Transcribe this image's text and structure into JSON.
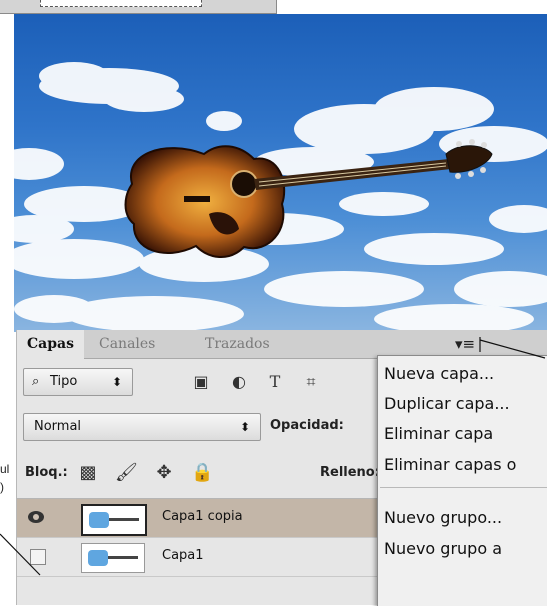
{
  "panel": {
    "tabs": [
      "Capas",
      "Canales",
      "Trazados"
    ],
    "menu_button_icon": "panel-menu-icon",
    "filter": {
      "kind_label": "Tipo"
    },
    "blend_mode": "Normal",
    "opacity_label": "Opacidad:",
    "lock_label": "Bloq.:",
    "fill_label": "Relleno:",
    "layers": [
      {
        "name": "Capa1 copia",
        "visible": true,
        "selected": true
      },
      {
        "name": "Capa1",
        "visible": false,
        "selected": false
      }
    ]
  },
  "context_menu": {
    "items": [
      "Nueva capa...",
      "Duplicar capa...",
      "Eliminar capa",
      "Eliminar capas o",
      "Nuevo grupo...",
      "Nuevo grupo a"
    ]
  },
  "edge_text": [
    "ul",
    ")"
  ]
}
